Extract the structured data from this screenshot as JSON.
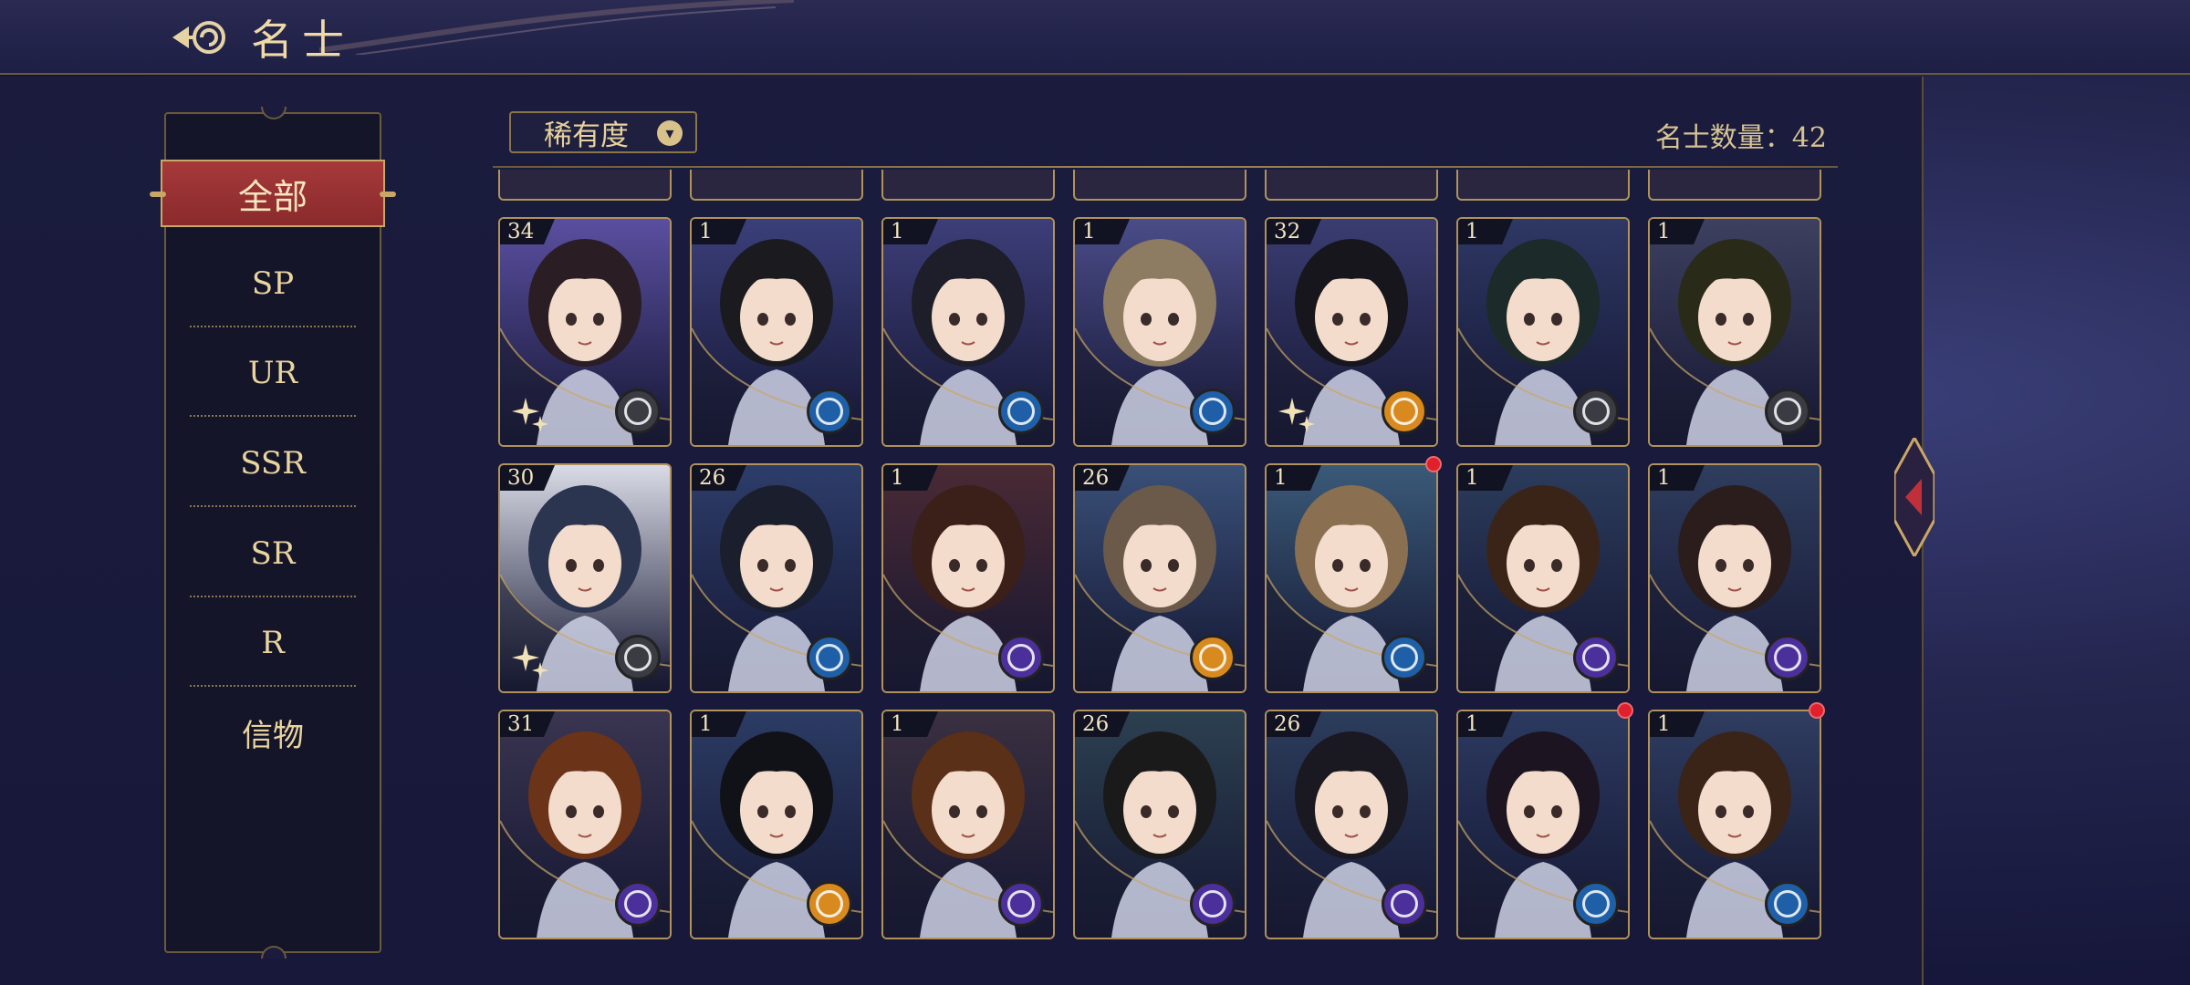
{
  "header": {
    "title": "名士"
  },
  "sidebar": {
    "items": [
      {
        "label": "全部",
        "active": true
      },
      {
        "label": "SP"
      },
      {
        "label": "UR"
      },
      {
        "label": "SSR"
      },
      {
        "label": "SR"
      },
      {
        "label": "R"
      },
      {
        "label": "信物"
      }
    ]
  },
  "filter": {
    "label": "稀有度",
    "count_label": "名士数量：42"
  },
  "colors": {
    "accent_red": "#9c3234",
    "gold": "#c9a766",
    "faction_gray": "#3b3b44",
    "faction_blue": "#1f5fa8",
    "faction_orange": "#d98a1f",
    "faction_purple": "#4b2f9a",
    "notify_red": "#e0202a"
  },
  "cards": [
    {
      "level": "34",
      "faction": "gray",
      "hair": "#2a1d24",
      "bg": "#5a4fa0",
      "sparkle": true
    },
    {
      "level": "1",
      "faction": "blue",
      "hair": "#1b1b1f",
      "bg": "#3b3f7a"
    },
    {
      "level": "1",
      "faction": "blue",
      "hair": "#1e1d2a",
      "bg": "#3d3e78"
    },
    {
      "level": "1",
      "faction": "blue",
      "hair": "#8d7c62",
      "bg": "#4a4c88"
    },
    {
      "level": "32",
      "faction": "orange",
      "hair": "#16161c",
      "bg": "#3b3d72",
      "sparkle": true
    },
    {
      "level": "1",
      "faction": "gray",
      "hair": "#1c2a2a",
      "bg": "#2e3864"
    },
    {
      "level": "1",
      "faction": "gray",
      "hair": "#2a2a18",
      "bg": "#3e4060"
    },
    {
      "level": "30",
      "faction": "gray",
      "hair": "#2b3550",
      "bg": "#d9dbe6",
      "sparkle": true
    },
    {
      "level": "26",
      "faction": "blue",
      "hair": "#1b1e2c",
      "bg": "#2d3d6a"
    },
    {
      "level": "1",
      "faction": "purple",
      "hair": "#3a2018",
      "bg": "#4a2a34"
    },
    {
      "level": "26",
      "faction": "orange",
      "hair": "#6b5a4a",
      "bg": "#3a5078"
    },
    {
      "level": "1",
      "faction": "blue",
      "hair": "#8a7050",
      "bg": "#3a5a78",
      "notify": true
    },
    {
      "level": "1",
      "faction": "purple",
      "hair": "#3a2418",
      "bg": "#2c3c5c"
    },
    {
      "level": "1",
      "faction": "purple",
      "hair": "#2a1d1c",
      "bg": "#2f3d5e"
    },
    {
      "level": "31",
      "faction": "purple",
      "hair": "#6b3418",
      "bg": "#3a3550"
    },
    {
      "level": "1",
      "faction": "orange",
      "hair": "#101218",
      "bg": "#2c3c64"
    },
    {
      "level": "1",
      "faction": "purple",
      "hair": "#5a3018",
      "bg": "#3a3040"
    },
    {
      "level": "26",
      "faction": "purple",
      "hair": "#1a1a1a",
      "bg": "#2c4050"
    },
    {
      "level": "26",
      "faction": "purple",
      "hair": "#1a1820",
      "bg": "#2c3d5c"
    },
    {
      "level": "1",
      "faction": "blue",
      "hair": "#1c1420",
      "bg": "#2c3a60",
      "notify": true
    },
    {
      "level": "1",
      "faction": "blue",
      "hair": "#3a2418",
      "bg": "#2f3d60",
      "notify": true
    }
  ]
}
